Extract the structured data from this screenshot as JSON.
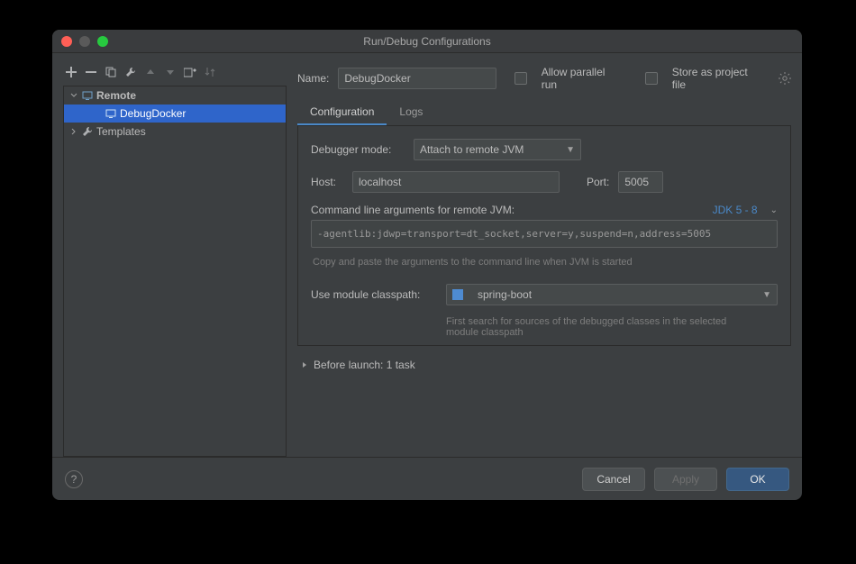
{
  "window": {
    "title": "Run/Debug Configurations"
  },
  "toolbar": {
    "add_tip": "+",
    "remove_tip": "−",
    "copy_tip": "copy",
    "wrench_tip": "settings",
    "up_tip": "up",
    "down_tip": "down",
    "folder_tip": "folder",
    "sort_tip": "sort"
  },
  "tree": {
    "remote_label": "Remote",
    "debugdocker_label": "DebugDocker",
    "templates_label": "Templates"
  },
  "header": {
    "name_label": "Name:",
    "name_value": "DebugDocker",
    "allow_parallel_label": "Allow parallel run",
    "store_label": "Store as project file"
  },
  "tabs": {
    "configuration": "Configuration",
    "logs": "Logs"
  },
  "form": {
    "debugger_mode_label": "Debugger mode:",
    "debugger_mode_value": "Attach to remote JVM",
    "host_label": "Host:",
    "host_value": "localhost",
    "port_label": "Port:",
    "port_value": "5005",
    "cmdline_label": "Command line arguments for remote JVM:",
    "jdk_label": "JDK 5 - 8",
    "cmdline_value": "-agentlib:jdwp=transport=dt_socket,server=y,suspend=n,address=5005",
    "cmdline_hint": "Copy and paste the arguments to the command line when JVM is started",
    "classpath_label": "Use module classpath:",
    "classpath_value": "spring-boot",
    "classpath_hint": "First search for sources of the debugged classes in the selected module classpath"
  },
  "before_launch": {
    "label": "Before launch: 1 task"
  },
  "footer": {
    "cancel": "Cancel",
    "apply": "Apply",
    "ok": "OK"
  }
}
